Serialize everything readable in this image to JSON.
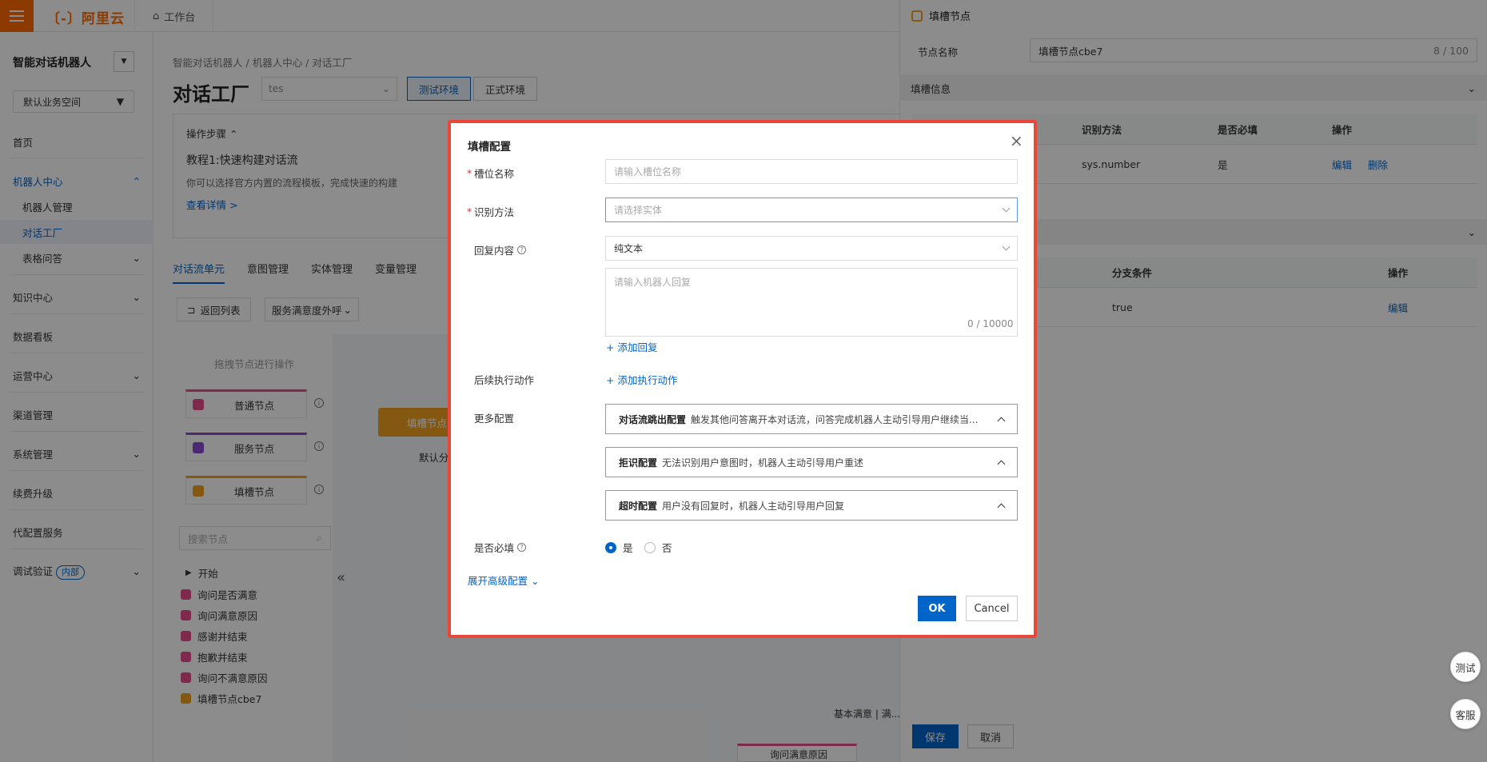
{
  "header": {
    "logo": "〔-〕阿里云",
    "worktab": "工作台"
  },
  "sidebar": {
    "title": "智能对话机器人",
    "workspace": "默认业务空间",
    "items": [
      "首页",
      "机器人中心",
      "机器人管理",
      "对话工厂",
      "表格问答",
      "知识中心",
      "数据看板",
      "运营中心",
      "渠道管理",
      "系统管理",
      "续费升级",
      "代配置服务",
      "调试验证"
    ],
    "badge": "内部"
  },
  "main": {
    "breadcrumb": [
      "智能对话机器人",
      "机器人中心",
      "对话工厂"
    ],
    "title": "对话工厂",
    "env_select": "tes",
    "env_test": "测试环境",
    "env_prod": "正式环境",
    "steps_title": "操作步骤",
    "tutorial_title": "教程1:快速构建对话流",
    "tutorial_desc": "你可以选择官方内置的流程模板，完成快速的构建",
    "tutorial_link": "查看详情 >",
    "tabs": [
      "对话流单元",
      "意图管理",
      "实体管理",
      "变量管理"
    ],
    "back_list": "返回列表",
    "flow_select": "服务满意度外呼",
    "palette_hint": "拖拽节点进行操作",
    "palette_nodes": [
      "普通节点",
      "服务节点",
      "填槽节点"
    ],
    "search_placeholder": "搜索节点",
    "tree": [
      "开始",
      "询问是否满意",
      "询问满意原因",
      "感谢并结束",
      "抱歉并结束",
      "询问不满意原因",
      "填槽节点cbe7"
    ],
    "canvas_node": "填槽节点",
    "canvas_text": "默认分",
    "canvas_label": "基本满意 | 满...",
    "canvas_bottom_node": "询问满意原因"
  },
  "right_panel": {
    "title": "填槽节点",
    "name_label": "节点名称",
    "name_value": "填槽节点cbe7",
    "name_count": "8 / 100",
    "section1": "填槽信息",
    "table1_headers": [
      "识别方法",
      "是否必填",
      "操作"
    ],
    "table1_row": [
      "sys.number",
      "是",
      "编辑",
      "删除"
    ],
    "table2_headers": [
      "分支条件",
      "操作"
    ],
    "table2_row": [
      "true",
      "编辑"
    ],
    "save": "保存",
    "cancel": "取消"
  },
  "float_buttons": [
    "测试",
    "客服"
  ],
  "modal": {
    "title": "填槽配置",
    "slot_name_label": "槽位名称",
    "slot_name_placeholder": "请输入槽位名称",
    "recognize_label": "识别方法",
    "recognize_placeholder": "请选择实体",
    "reply_label": "回复内容",
    "reply_type": "纯文本",
    "reply_placeholder": "请输入机器人回复",
    "reply_count": "0 / 10000",
    "add_reply": "+ 添加回复",
    "followup_label": "后续执行动作",
    "add_action": "+ 添加执行动作",
    "more_label": "更多配置",
    "configs": [
      {
        "name": "对话流跳出配置",
        "desc": "触发其他问答离开本对话流，问答完成机器人主动引导用户继续当..."
      },
      {
        "name": "拒识配置",
        "desc": "无法识别用户意图时，机器人主动引导用户重述"
      },
      {
        "name": "超时配置",
        "desc": "用户没有回复时，机器人主动引导用户回复"
      }
    ],
    "required_label": "是否必填",
    "yes": "是",
    "no": "否",
    "advanced": "展开高级配置",
    "ok": "OK",
    "cancel": "Cancel"
  },
  "colors": {
    "accent": "#0064c8",
    "brand": "#ff6a00",
    "modal_border": "#e8473a"
  }
}
